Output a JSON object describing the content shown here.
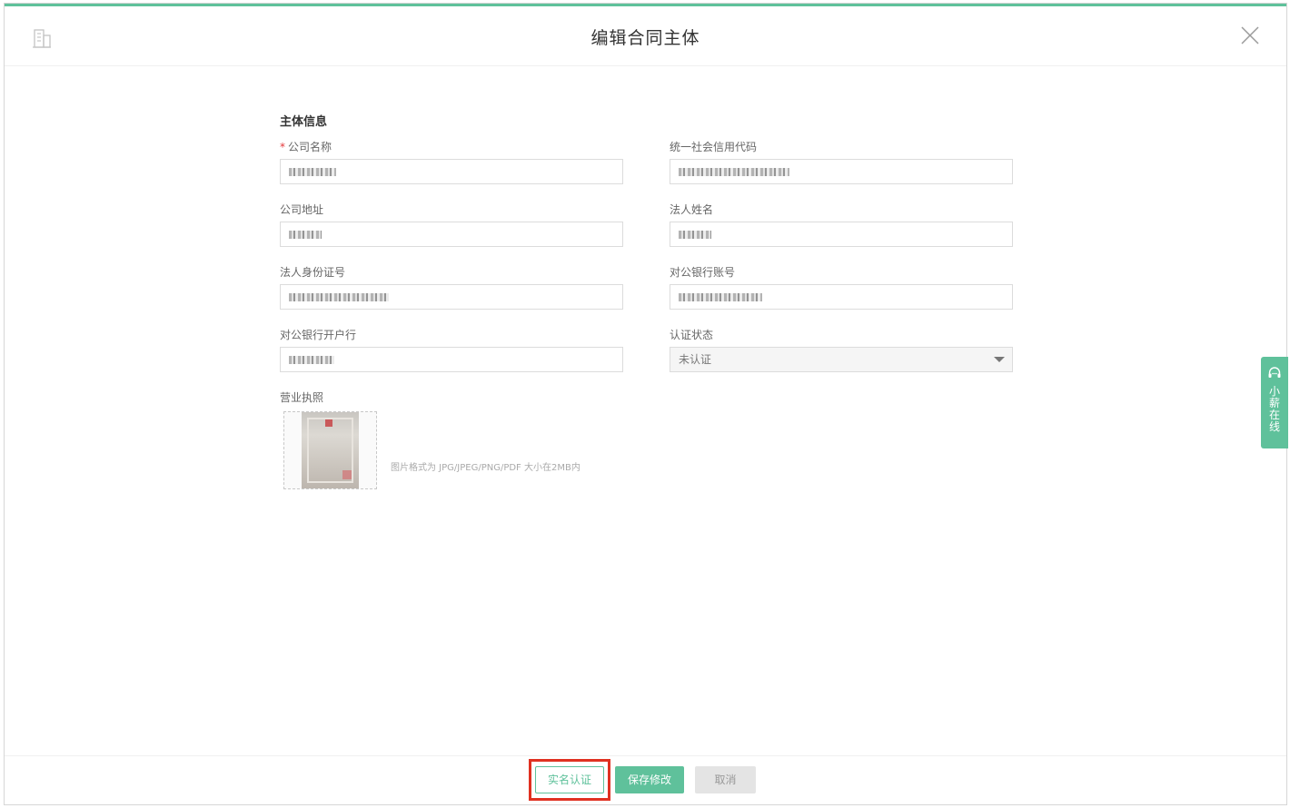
{
  "header": {
    "title": "编辑合同主体",
    "logo_icon": "building-icon",
    "close_icon": "close-icon"
  },
  "form": {
    "section_title": "主体信息",
    "fields": {
      "company_name": {
        "label": "公司名称",
        "required": "*",
        "value": "[redacted]"
      },
      "credit_code": {
        "label": "统一社会信用代码",
        "value": "[redacted]"
      },
      "company_address": {
        "label": "公司地址",
        "value": "[redacted]"
      },
      "legal_person": {
        "label": "法人姓名",
        "value": "[redacted]"
      },
      "legal_id": {
        "label": "法人身份证号",
        "value": "[redacted]"
      },
      "bank_account": {
        "label": "对公银行账号",
        "value": "[redacted]"
      },
      "bank_name": {
        "label": "对公银行开户行",
        "value": "[redacted]"
      },
      "cert_status": {
        "label": "认证状态",
        "value": "未认证"
      }
    },
    "license": {
      "label": "营业执照",
      "hint": "图片格式为 JPG/JPEG/PNG/PDF 大小在2MB内"
    }
  },
  "side_widget": {
    "label": "小薪在线",
    "icon": "headset-icon"
  },
  "footer": {
    "verify_label": "实名认证",
    "save_label": "保存修改",
    "cancel_label": "取消"
  },
  "colors": {
    "accent": "#5fc19b",
    "highlight": "#e03121",
    "required": "#e4393c"
  }
}
